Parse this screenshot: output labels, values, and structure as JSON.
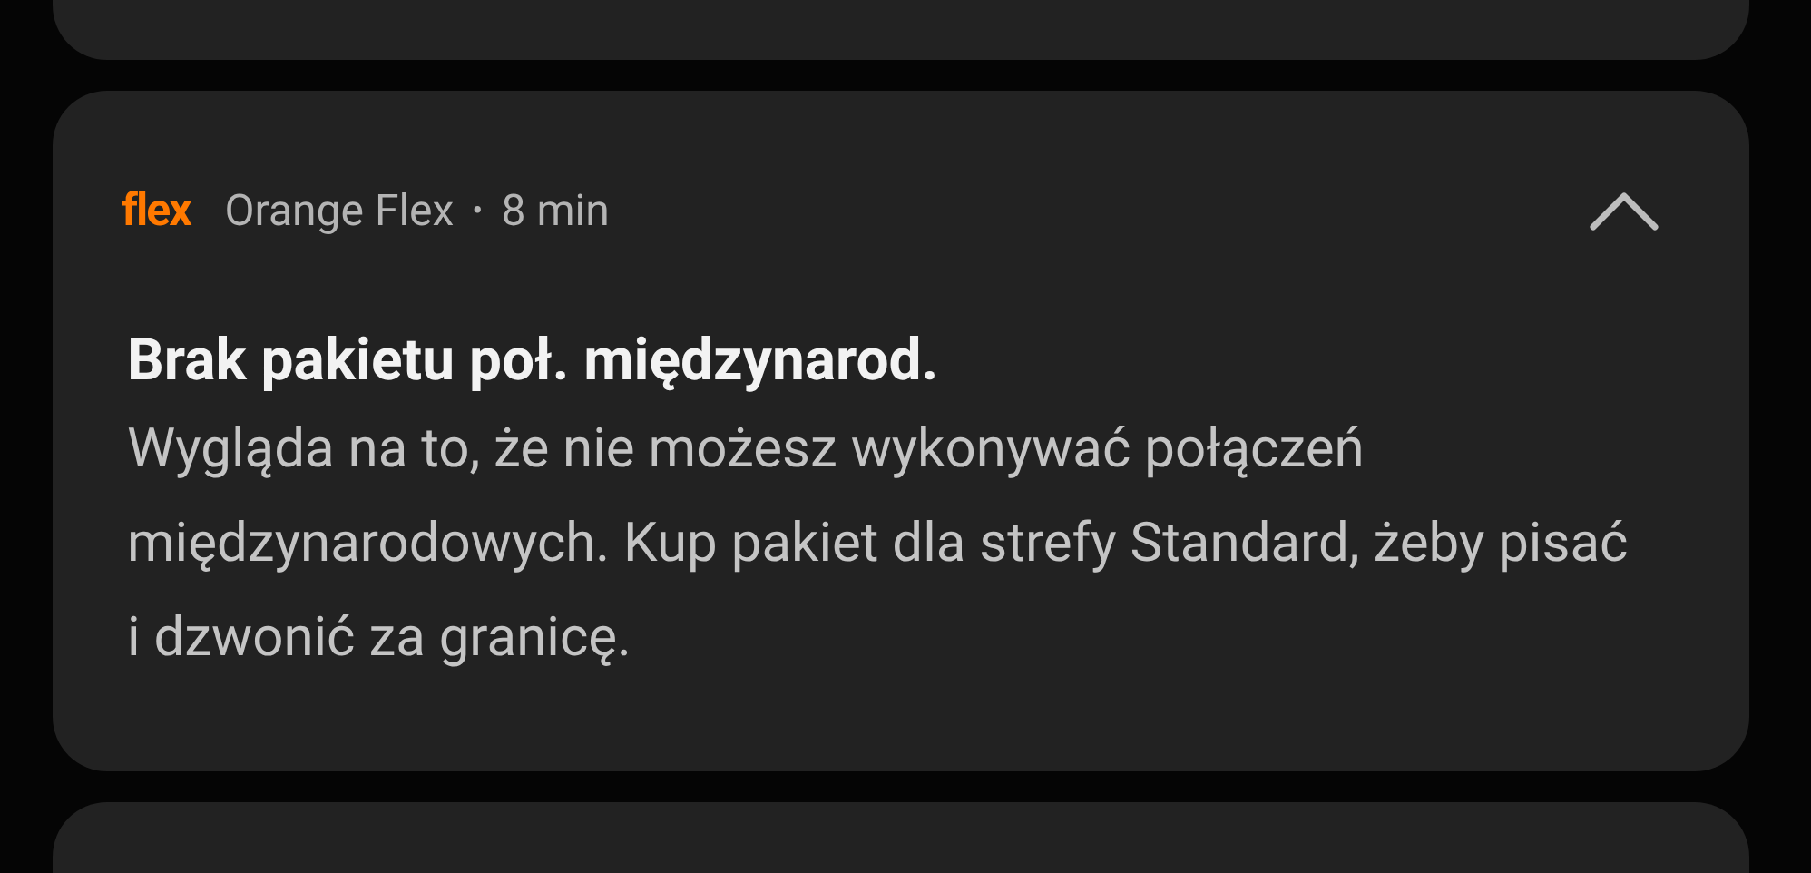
{
  "notification": {
    "app_logo": "flex",
    "app_name": "Orange Flex",
    "separator": "•",
    "time": "8 min",
    "expanded": true,
    "title": "Brak pakietu poł. międzynarod.",
    "body": "Wygląda na to, że nie możesz wykonywać połączeń międzynarodowych. Kup pakiet dla strefy Standard, żeby pisać i dzwonić za granicę."
  }
}
